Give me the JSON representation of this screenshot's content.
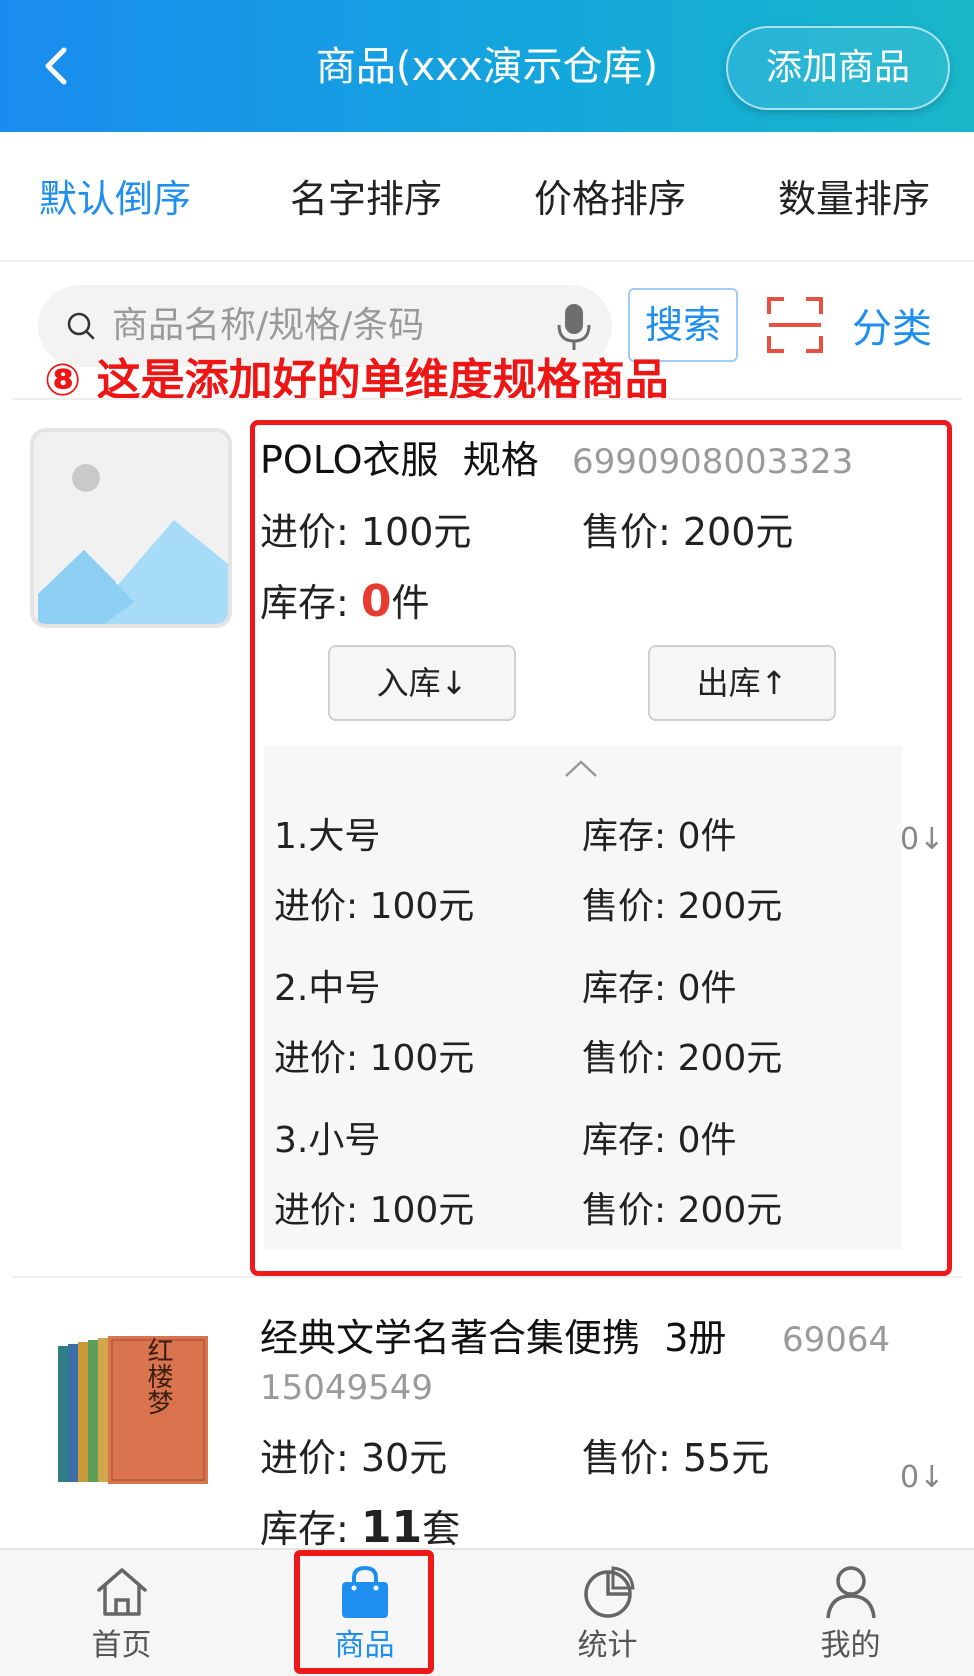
{
  "header": {
    "back_icon": "chevron-left-icon",
    "title": "商品(xxx演示仓库)",
    "add_button_label": "添加商品"
  },
  "sort_tabs": [
    {
      "label": "默认倒序",
      "active": true
    },
    {
      "label": "名字排序",
      "active": false
    },
    {
      "label": "价格排序",
      "active": false
    },
    {
      "label": "数量排序",
      "active": false
    }
  ],
  "search": {
    "placeholder": "商品名称/规格/条码",
    "button_label": "搜索",
    "category_label": "分类",
    "icons": [
      "search-icon",
      "microphone-icon",
      "scan-icon"
    ]
  },
  "annotation": {
    "step_label": "⑧ 这是添加好的单维度规格商品"
  },
  "products": [
    {
      "name": "POLO衣服",
      "spec": "规格",
      "barcode": "6990908003323",
      "purchase_price": "进价: 100元",
      "sale_price": "售价: 200元",
      "stock_label": "库存: ",
      "stock_value": "0",
      "stock_unit": "件",
      "in_button": "入库↓",
      "out_button": "出库↑",
      "side_count": "0↓",
      "variants": [
        {
          "name": "1.大号",
          "stock": "库存: 0件",
          "purchase": "进价: 100元",
          "sale": "售价: 200元"
        },
        {
          "name": "2.中号",
          "stock": "库存: 0件",
          "purchase": "进价: 100元",
          "sale": "售价: 200元"
        },
        {
          "name": "3.小号",
          "stock": "库存: 0件",
          "purchase": "进价: 100元",
          "sale": "售价: 200元"
        }
      ]
    },
    {
      "name": "经典文学名著合集便携",
      "spec": "3册",
      "barcode_line1": "69064",
      "barcode_line2": "15049549",
      "purchase_price": "进价: 30元",
      "sale_price": "售价: 55元",
      "stock_label": "库存: ",
      "stock_value": "11",
      "stock_unit": "套",
      "side_count": "0↓",
      "cover_title": "红楼梦"
    }
  ],
  "tabbar": [
    {
      "label": "首页",
      "icon": "home-icon",
      "active": false
    },
    {
      "label": "商品",
      "icon": "shopping-bag-icon",
      "active": true
    },
    {
      "label": "统计",
      "icon": "pie-chart-icon",
      "active": false
    },
    {
      "label": "我的",
      "icon": "user-icon",
      "active": false
    }
  ],
  "colors": {
    "header_gradient_start": "#1a8cf0",
    "header_gradient_end": "#19b7c9",
    "accent_blue": "#1e8ff0",
    "annotation_red": "#ee1515",
    "stock_zero_red": "#e83a2e"
  }
}
